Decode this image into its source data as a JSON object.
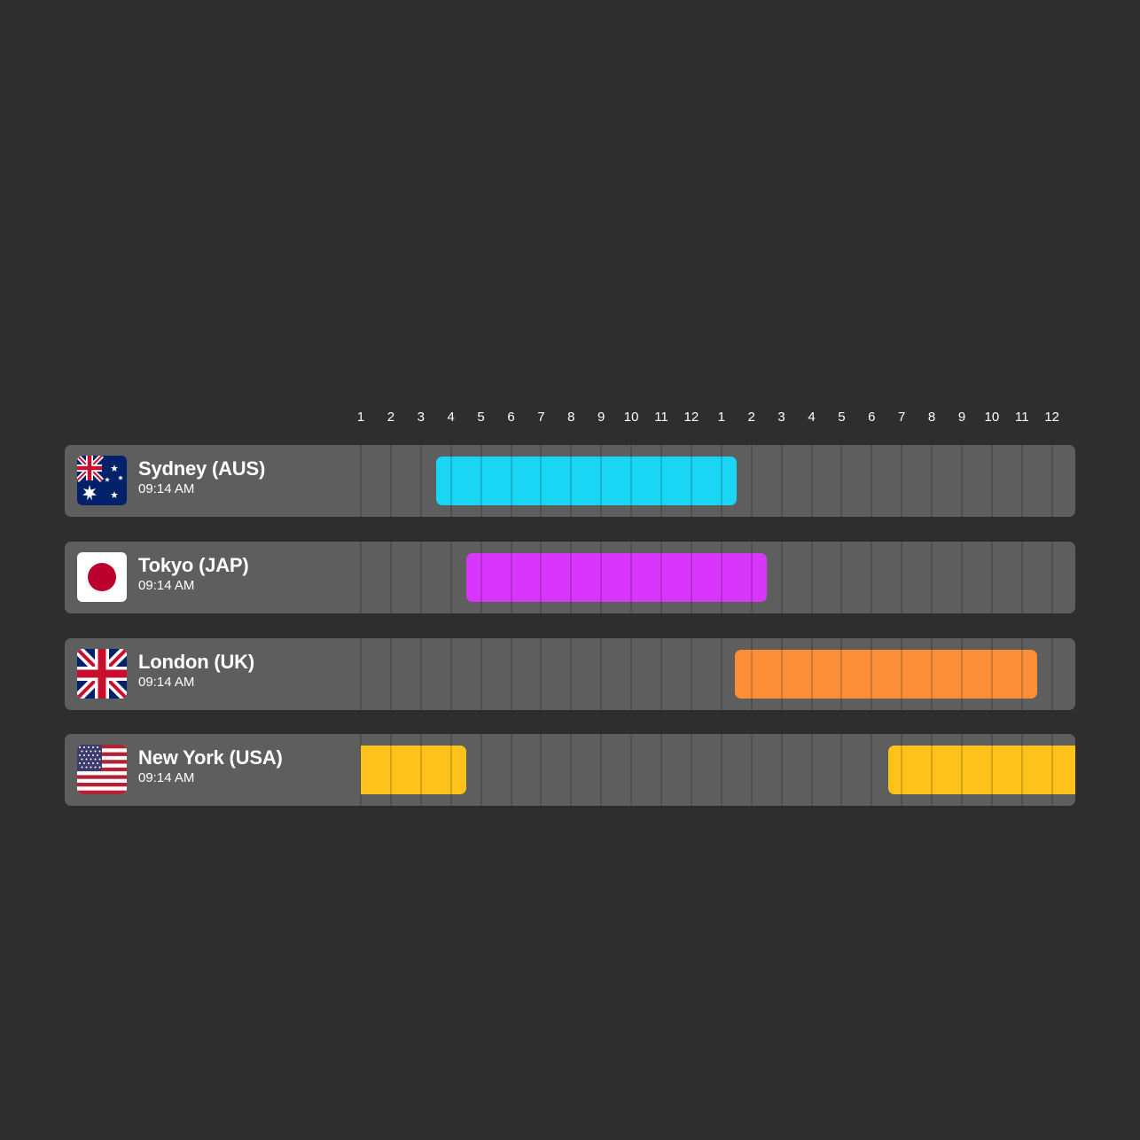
{
  "hour_labels": [
    "1",
    "2",
    "3",
    "4",
    "5",
    "6",
    "7",
    "8",
    "9",
    "10",
    "11",
    "12",
    "1",
    "2",
    "3",
    "4",
    "5",
    "6",
    "7",
    "8",
    "9",
    "10",
    "11",
    "12"
  ],
  "rows": [
    {
      "city": "Sydney (AUS)",
      "time": "09:14 AM",
      "flag_icon": "australia-flag-icon",
      "color": "#1ad6f5",
      "ranges": [
        {
          "start": 2.5,
          "end": 12.5
        }
      ]
    },
    {
      "city": "Tokyo (JAP)",
      "time": "09:14 AM",
      "flag_icon": "japan-flag-icon",
      "color": "#d836fb",
      "ranges": [
        {
          "start": 3.5,
          "end": 13.5
        }
      ]
    },
    {
      "city": "London (UK)",
      "time": "09:14 AM",
      "flag_icon": "uk-flag-icon",
      "color": "#fb8e37",
      "ranges": [
        {
          "start": 12.45,
          "end": 22.5
        }
      ]
    },
    {
      "city": "New York (USA)",
      "time": "09:14 AM",
      "flag_icon": "usa-flag-icon",
      "color": "#ffc21a",
      "ranges": [
        {
          "start": 0,
          "end": 3.5
        },
        {
          "start": 17.55,
          "end": 24.5
        }
      ]
    }
  ]
}
